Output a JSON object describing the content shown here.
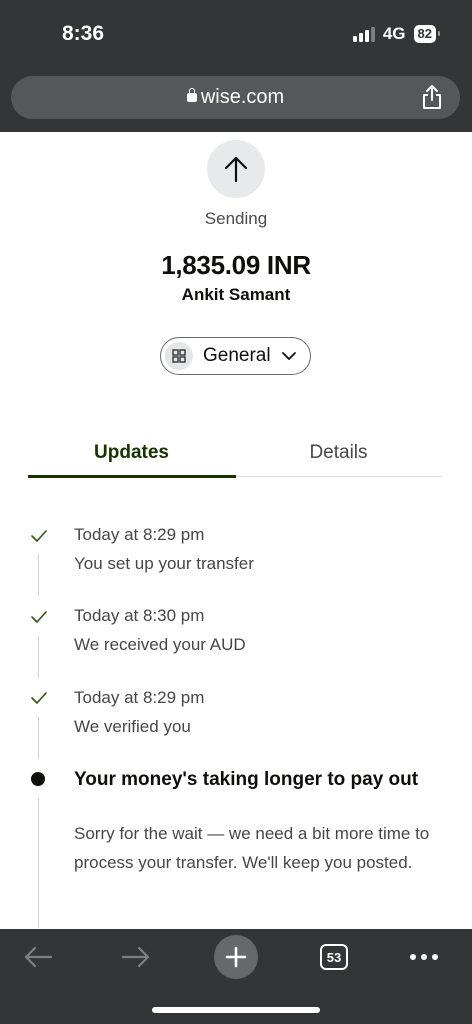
{
  "status_bar": {
    "time": "8:36",
    "network": "4G",
    "battery": "82"
  },
  "browser": {
    "url": "wise.com"
  },
  "transfer": {
    "status": "Sending",
    "amount": "1,835.09 INR",
    "recipient": "Ankit Samant",
    "category": "General"
  },
  "tabs": [
    {
      "label": "Updates"
    },
    {
      "label": "Details"
    }
  ],
  "events": [
    {
      "time": "Today at 8:29 pm",
      "text": "You set up your transfer"
    },
    {
      "time": "Today at 8:30 pm",
      "text": "We received your AUD"
    },
    {
      "time": "Today at 8:29 pm",
      "text": "We verified you"
    }
  ],
  "notice": {
    "title": "Your money's taking longer to pay out",
    "body": "Sorry for the wait — we need a bit more time to process your transfer. We'll keep you posted."
  },
  "toolbar": {
    "tab_count": "53"
  },
  "colors": {
    "accent": "#163300",
    "check": "#2f5711",
    "chrome": "#333537"
  }
}
